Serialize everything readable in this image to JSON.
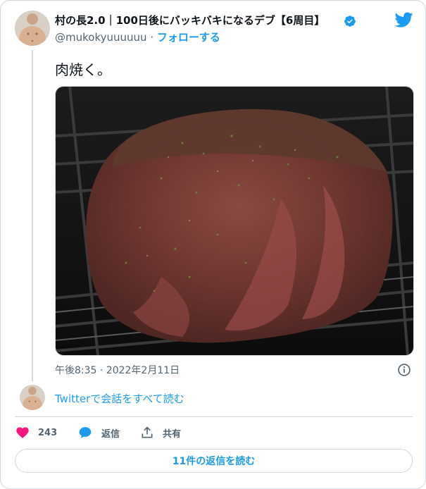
{
  "author": {
    "display_name": "村の長2.0｜100日後にバッキバキになるデブ【6周目】",
    "handle": "@mukokyuuuuuu",
    "separator": "·",
    "follow_label": "フォローする",
    "avatar_icon": "user-avatar",
    "verified_icon": "verified-badge-icon",
    "verified_color": "#1d9bf0"
  },
  "brand": {
    "icon": "twitter-bird-icon",
    "color": "#1d9bf0"
  },
  "tweet": {
    "text": "肉焼く。",
    "media_icon": "roast-meat-photo",
    "timestamp": "午後8:35 · 2022年2月11日"
  },
  "conversation": {
    "read_label": "Twitterで会話をすべて読む"
  },
  "actions": {
    "like_count": "243",
    "like_color": "#f91880",
    "reply_label": "返信",
    "share_label": "共有"
  },
  "footer": {
    "read_replies_label": "11件の返信を読む"
  }
}
